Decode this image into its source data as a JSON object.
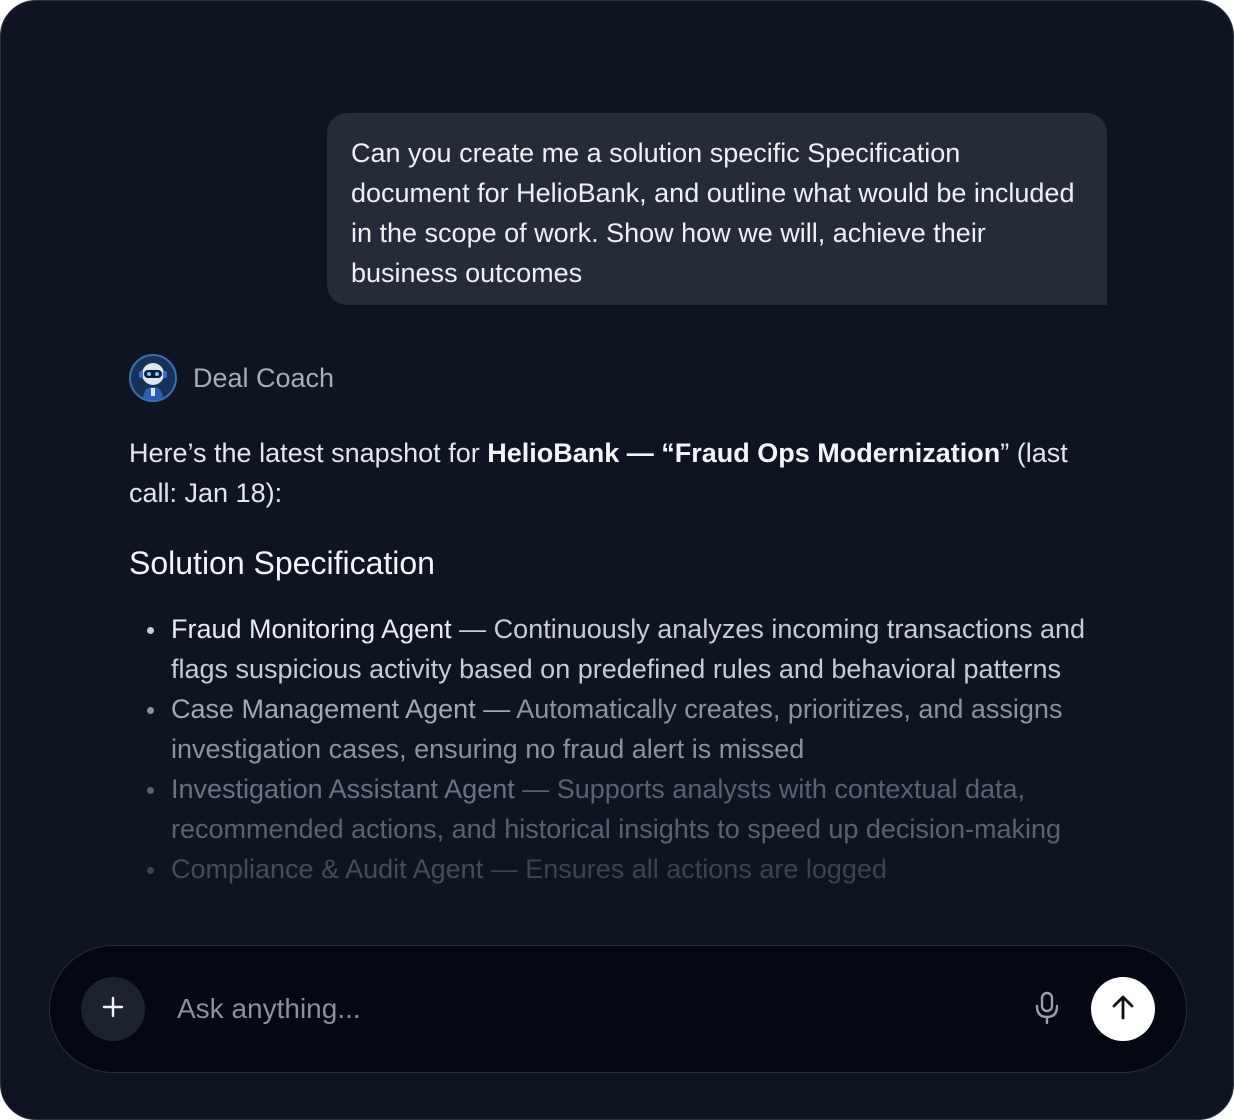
{
  "user_message": {
    "text": "Can you create me a solution specific Specification document for HelioBank, and outline what would be included in the scope of work. Show how we will, achieve their business outcomes"
  },
  "assistant": {
    "name": "Deal Coach",
    "avatar_icon": "robot-avatar-icon",
    "intro_prefix": "Here’s the latest snapshot for ",
    "intro_bold": "HelioBank — “Fraud Ops Modernization",
    "intro_suffix": "” (last call: Jan 18):",
    "heading": "Solution Specification",
    "bullets": [
      {
        "title": "Fraud Monitoring Agent",
        "description": " — Continuously analyzes incoming transactions and flags suspicious activity based on predefined rules and behavioral patterns"
      },
      {
        "title": "Case Management Agent —",
        "description": " Automatically creates, prioritizes, and assigns investigation cases, ensuring no fraud alert is missed"
      },
      {
        "title": "Investigation Assistant Agent",
        "description": " — Supports analysts with contextual data, recommended actions, and historical insights to speed up decision-making"
      },
      {
        "title": "Compliance & Audit Agent",
        "description": " — Ensures all actions are logged"
      }
    ]
  },
  "composer": {
    "placeholder": "Ask anything...",
    "plus_icon": "plus-icon",
    "mic_icon": "microphone-icon",
    "send_icon": "arrow-up-icon"
  },
  "colors": {
    "background": "#0e1422",
    "user_bubble": "#252b38",
    "composer": "#030812",
    "send_button": "#ffffff"
  }
}
